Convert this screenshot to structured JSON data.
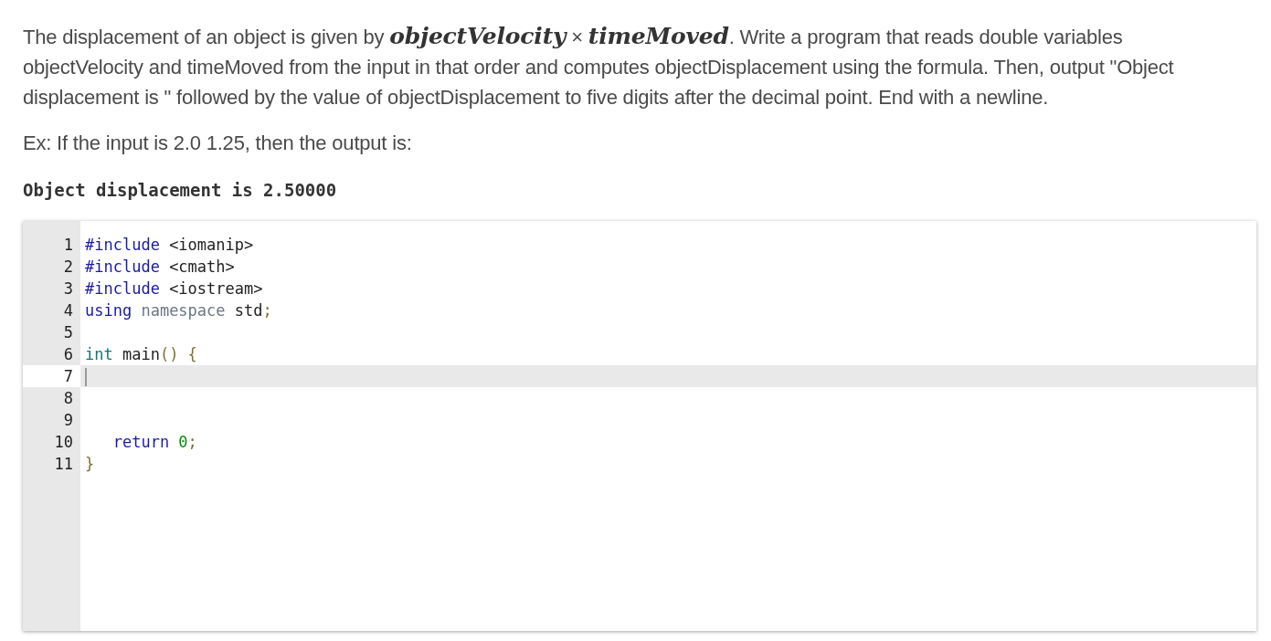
{
  "prompt": {
    "paragraph": "The displacement of an object is given by *objectVelocity* × *timeMoved*. Write a program that reads double variables objectVelocity and timeMoved from the input in that order and computes objectDisplacement using the formula. Then, output \"Object displacement is \" followed by the value of objectDisplacement to five digits after the decimal point. End with a newline.",
    "example": "Ex: If the input is 2.0 1.25, then the output is:",
    "output": "Object displacement is 2.50000"
  },
  "editor": {
    "lines": [
      {
        "number": "1",
        "active": false,
        "tokens": [
          {
            "text": "#include",
            "kind": "directive"
          },
          {
            "text": " <iomanip>",
            "kind": "plain"
          }
        ]
      },
      {
        "number": "2",
        "active": false,
        "tokens": [
          {
            "text": "#include",
            "kind": "directive"
          },
          {
            "text": " <cmath>",
            "kind": "plain"
          }
        ]
      },
      {
        "number": "3",
        "active": false,
        "tokens": [
          {
            "text": "#include",
            "kind": "directive"
          },
          {
            "text": " <iostream>",
            "kind": "plain"
          }
        ]
      },
      {
        "number": "4",
        "active": false,
        "tokens": [
          {
            "text": "using",
            "kind": "keyword"
          },
          {
            "text": " namespace",
            "kind": "muted"
          },
          {
            "text": " std",
            "kind": "plain"
          },
          {
            "text": ";",
            "kind": "punct"
          }
        ]
      },
      {
        "number": "5",
        "active": false
      },
      {
        "number": "6",
        "active": false,
        "tokens": [
          {
            "text": "int",
            "kind": "type"
          },
          {
            "text": " main",
            "kind": "plain"
          },
          {
            "text": "() {",
            "kind": "punct"
          }
        ]
      },
      {
        "number": "7",
        "active": true
      },
      {
        "number": "8",
        "active": false
      },
      {
        "number": "9",
        "active": false
      },
      {
        "number": "10",
        "active": false,
        "tokens": [
          {
            "text": "   return",
            "kind": "keyword"
          },
          {
            "text": " 0",
            "kind": "number"
          },
          {
            "text": ";",
            "kind": "punct"
          }
        ]
      },
      {
        "number": "11",
        "active": false,
        "tokens": [
          {
            "text": "}",
            "kind": "punct"
          }
        ]
      }
    ]
  }
}
